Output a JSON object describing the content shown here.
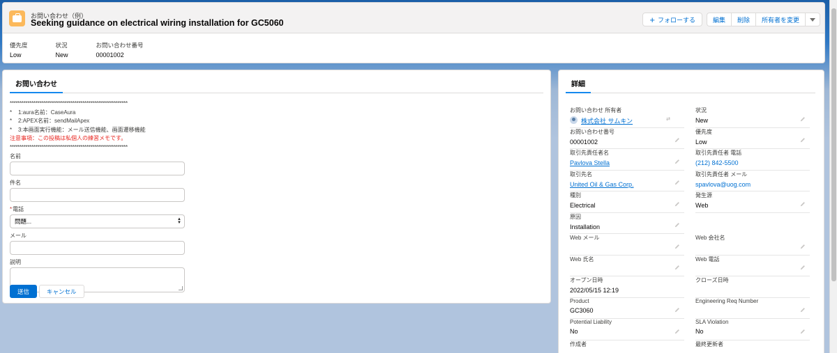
{
  "header": {
    "object_label": "お問い合わせ（例）",
    "title": "Seeking guidance on electrical wiring installation for GC5060",
    "icon": "case-icon",
    "actions": {
      "follow": "フォローする",
      "edit": "編集",
      "delete": "削除",
      "change_owner": "所有者を変更"
    },
    "fields": [
      {
        "label": "優先度",
        "value": "Low"
      },
      {
        "label": "状況",
        "value": "New"
      },
      {
        "label": "お問い合わせ番号",
        "value": "00001002"
      }
    ]
  },
  "inquiry": {
    "tab": "お問い合わせ",
    "stars": "************************************************************",
    "notes": [
      "1:aura名前：CaseAura",
      "2:APEX名前：sendMailApex",
      "3:本画面実行機能：メール送信機能、画面遷移機能"
    ],
    "warning": "注意事項：この投稿は私個人の練習メモです。",
    "form": {
      "name_label": "名前",
      "subject_label": "件名",
      "phone_label": "電話",
      "phone_value": "問題...",
      "email_label": "メール",
      "description_label": "説明",
      "submit": "送信",
      "cancel": "キャンセル"
    }
  },
  "details": {
    "tab": "詳細",
    "rows": [
      [
        {
          "label": "お問い合わせ 所有者",
          "value": "株式会社 サムキン"
        },
        {
          "label": "状況",
          "value": "New"
        }
      ],
      [
        {
          "label": "お問い合わせ番号",
          "value": "00001002"
        },
        {
          "label": "優先度",
          "value": "Low"
        }
      ],
      [
        {
          "label": "取引先責任者名",
          "value": "Pavlova Stella"
        },
        {
          "label": "取引先責任者 電話",
          "value": "(212) 842-5500"
        }
      ],
      [
        {
          "label": "取引先名",
          "value": "United Oil & Gas Corp."
        },
        {
          "label": "取引先責任者 メール",
          "value": "spavlova@uog.com"
        }
      ],
      [
        {
          "label": "種別",
          "value": "Electrical"
        },
        {
          "label": "発生源",
          "value": "Web"
        }
      ],
      [
        {
          "label": "原因",
          "value": "Installation"
        },
        {
          "label": "",
          "value": ""
        }
      ],
      [
        {
          "label": "Web メール",
          "value": ""
        },
        {
          "label": "Web 会社名",
          "value": ""
        }
      ],
      [
        {
          "label": "Web 氏名",
          "value": ""
        },
        {
          "label": "Web 電話",
          "value": ""
        }
      ],
      [
        {
          "label": "オープン日時",
          "value": "2022/05/15 12:19"
        },
        {
          "label": "クローズ日時",
          "value": ""
        }
      ],
      [
        {
          "label": "Product",
          "value": "GC3060"
        },
        {
          "label": "Engineering Req Number",
          "value": ""
        }
      ],
      [
        {
          "label": "Potential Liability",
          "value": "No"
        },
        {
          "label": "SLA Violation",
          "value": "No"
        }
      ],
      [
        {
          "label": "作成者",
          "value": ""
        },
        {
          "label": "最終更新者",
          "value": ""
        }
      ]
    ]
  }
}
